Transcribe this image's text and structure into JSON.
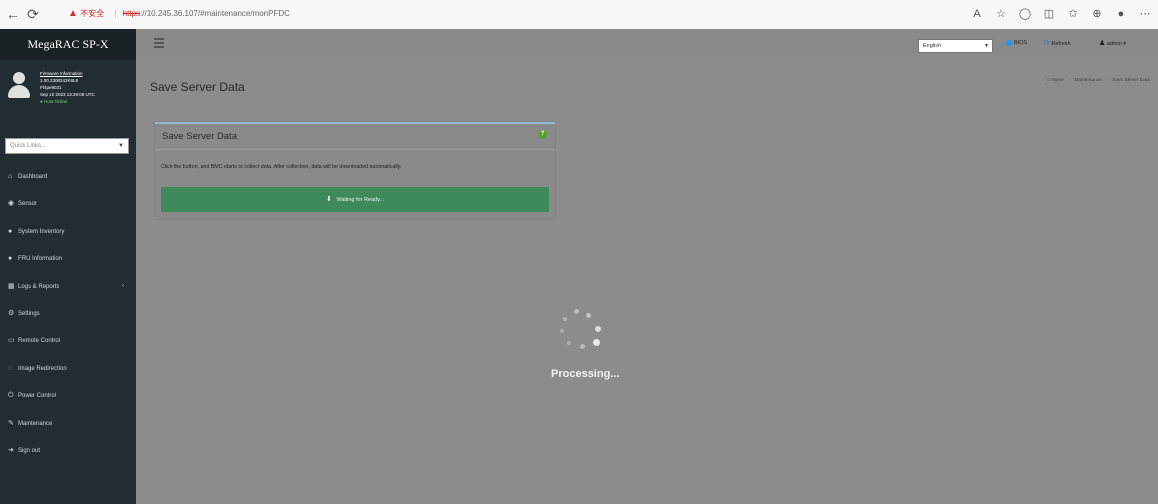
{
  "browser": {
    "security_label": "不安全",
    "protocol": "https",
    "url_rest": "://10.245.36.107/#maintenance/monPFDC"
  },
  "sidebar": {
    "brand": "MegaRAC SP-X",
    "user": {
      "firmware_label": "Firmware Information",
      "firmware_version": "1.00.2308242K8L8",
      "firmware_sub": "Ff4pe9031",
      "datetime": "Sep 10 2023 13:29:08 UTC",
      "status": "Host Online"
    },
    "quick_links_placeholder": "Quick Links...",
    "items": [
      {
        "label": "Dashboard",
        "icon": "dashboard-icon"
      },
      {
        "label": "Sensor",
        "icon": "sensor-icon"
      },
      {
        "label": "System Inventory",
        "icon": "inventory-icon"
      },
      {
        "label": "FRU Information",
        "icon": "info-icon"
      },
      {
        "label": "Logs & Reports",
        "icon": "chart-icon"
      },
      {
        "label": "Settings",
        "icon": "gear-icon"
      },
      {
        "label": "Remote Control",
        "icon": "monitor-icon"
      },
      {
        "label": "Image Redirection",
        "icon": "cd-icon"
      },
      {
        "label": "Power Control",
        "icon": "power-icon"
      },
      {
        "label": "Maintenance",
        "icon": "wrench-icon"
      },
      {
        "label": "Sign out",
        "icon": "signout-icon"
      }
    ]
  },
  "topbar": {
    "language": "English",
    "bios_label": "BIOS",
    "refresh_label": "Refresh",
    "user_label": "admin"
  },
  "page": {
    "title": "Save Server Data",
    "breadcrumb": [
      "Home",
      "Maintenance",
      "Save Server Data"
    ]
  },
  "panel": {
    "title": "Save Server Data",
    "help_icon_text": "?",
    "description": "Click the button, and BMC starts to collect data. After collection, data will be downloaded automatically.",
    "button_label": "Waiting for Ready..."
  },
  "overlay": {
    "text": "Processing..."
  },
  "colors": {
    "sidebar": "#222d32",
    "overlay_gray": "#8c8c8c",
    "button_green": "#3f8a5a",
    "bios_blue": "#2196f3"
  }
}
